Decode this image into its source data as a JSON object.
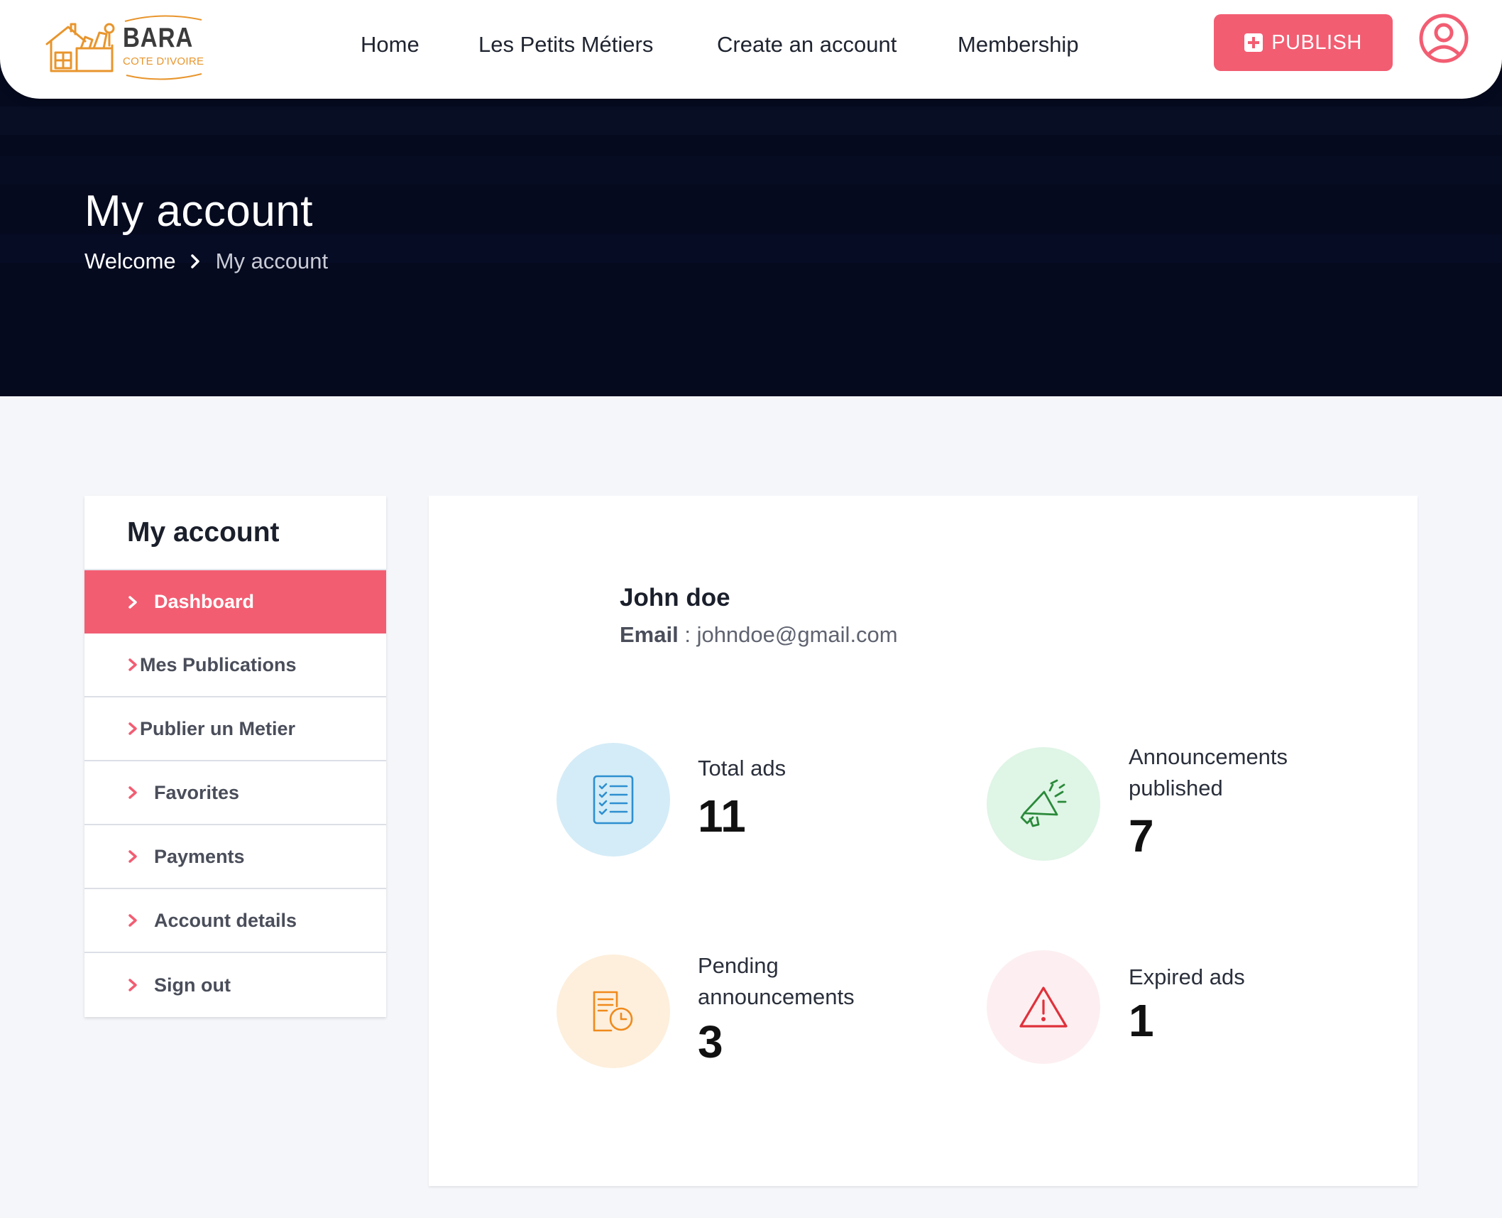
{
  "brand": {
    "name": "BARA",
    "tagline": "COTE D'IVOIRE",
    "accent_color": "#f25d72",
    "logo_color": "#e8952c"
  },
  "nav": {
    "items": [
      "Home",
      "Les Petits Métiers",
      "Create an account",
      "Membership"
    ],
    "publish_label": "PUBLISH"
  },
  "hero": {
    "title": "My account",
    "breadcrumb": {
      "home": "Welcome",
      "current": "My account"
    }
  },
  "sidebar": {
    "title": "My account",
    "items": [
      {
        "label": "Dashboard",
        "active": true
      },
      {
        "label": "Mes Publications",
        "active": false
      },
      {
        "label": "Publier un Metier",
        "active": false
      },
      {
        "label": "Favorites",
        "active": false
      },
      {
        "label": "Payments",
        "active": false
      },
      {
        "label": "Account details",
        "active": false
      },
      {
        "label": "Sign out",
        "active": false
      }
    ]
  },
  "profile": {
    "name": "John doe",
    "email_label": "Email",
    "email_separator": " : ",
    "email": "johndoe@gmail.com"
  },
  "stats": [
    {
      "label": "Total ads",
      "value": "11",
      "icon": "checklist-icon",
      "color": "#2e8fd0",
      "bg": "#d4ecf7"
    },
    {
      "label": "Announcements published",
      "value": "7",
      "icon": "megaphone-icon",
      "color": "#2a8a3a",
      "bg": "#dff5e6"
    },
    {
      "label": "Pending announcements",
      "value": "3",
      "icon": "document-clock-icon",
      "color": "#f08a1c",
      "bg": "#fdefdc"
    },
    {
      "label": "Expired ads",
      "value": "1",
      "icon": "warning-icon",
      "color": "#e0313b",
      "bg": "#fdeff1"
    }
  ]
}
